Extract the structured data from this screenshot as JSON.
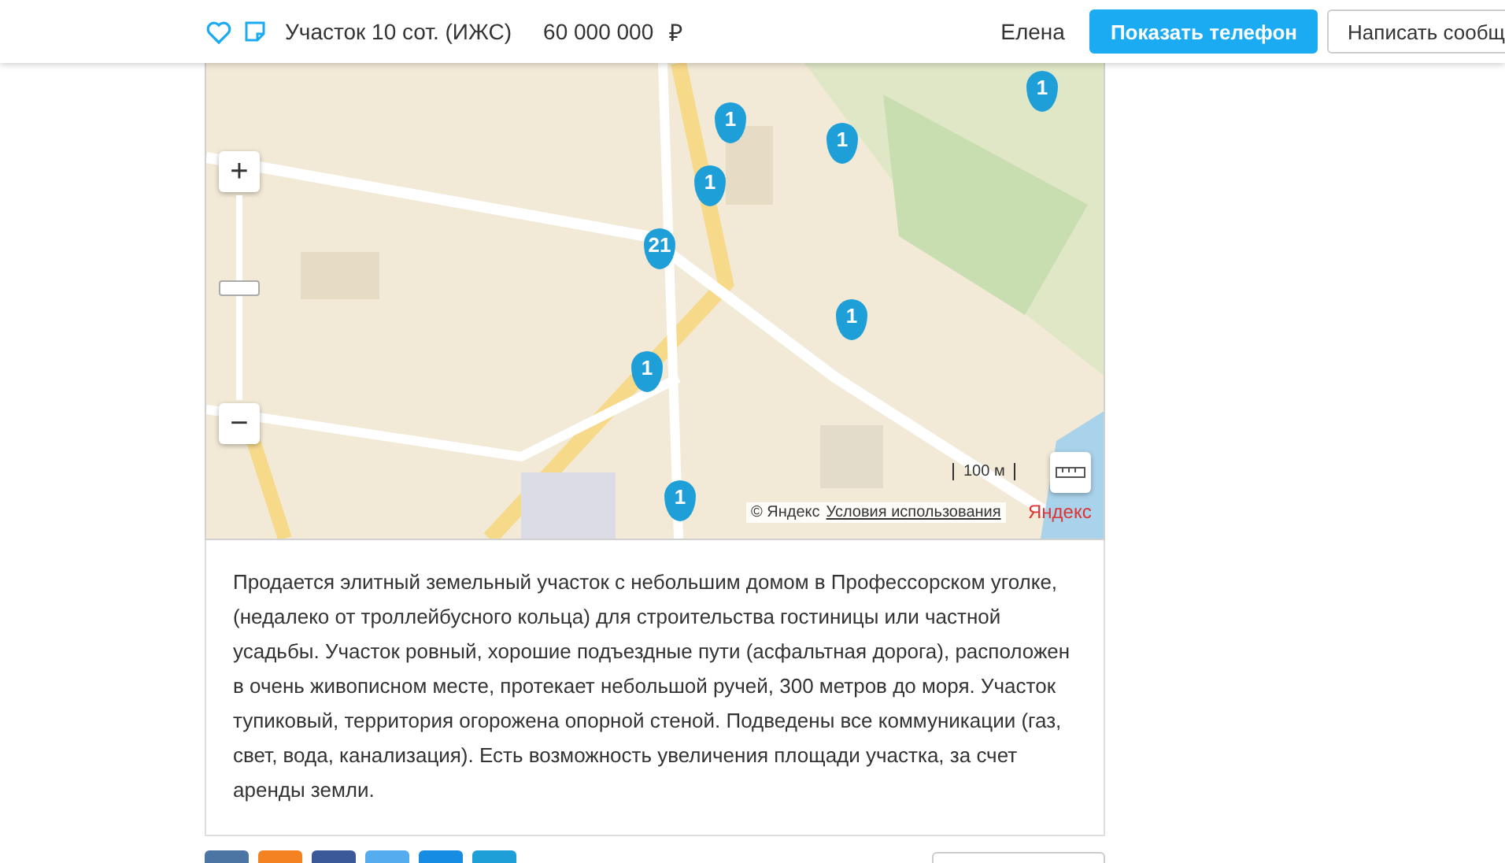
{
  "header": {
    "title": "Участок 10 сот. (ИЖС)",
    "price": "60 000 000",
    "currency": "₽",
    "seller": "Елена",
    "buttons": [
      "Показать телефон",
      "Написать сообщ"
    ],
    "favorite": false
  },
  "map": {
    "markers": [
      "1",
      "1",
      "1",
      "1",
      "1",
      "1",
      "1",
      "21"
    ],
    "scale": "100 м",
    "copyright": "© Яндекс",
    "terms": "Условия использования",
    "logo": "Яндекс",
    "zoom_in": "+",
    "zoom_out": "−",
    "zoom": {
      "level": 0.55
    }
  },
  "description": "Продается элитный земельный участок с небольшим домом в Профессорском уголке, (недалеко от троллейбусного кольца) для строительства гостиницы или частной усадьбы. Участок ровный, хорошие подъездные пути (асфальтная дорога), расположен в очень живописном месте, протекает небольшой ручей, 300 метров до моря. Участок тупиковый, территория огорожена опорной стеной. Подведены все коммуникации (газ, свет, вода, канализация). Есть возможность увеличения площади участка, за счет аренды земли.",
  "share": [
    {
      "color": "#4c75a3"
    },
    {
      "color": "#f58220"
    },
    {
      "color": "#3b5998"
    },
    {
      "color": "#55acee"
    },
    {
      "color": "#168de2"
    },
    {
      "color": "#1e9fd8"
    }
  ]
}
